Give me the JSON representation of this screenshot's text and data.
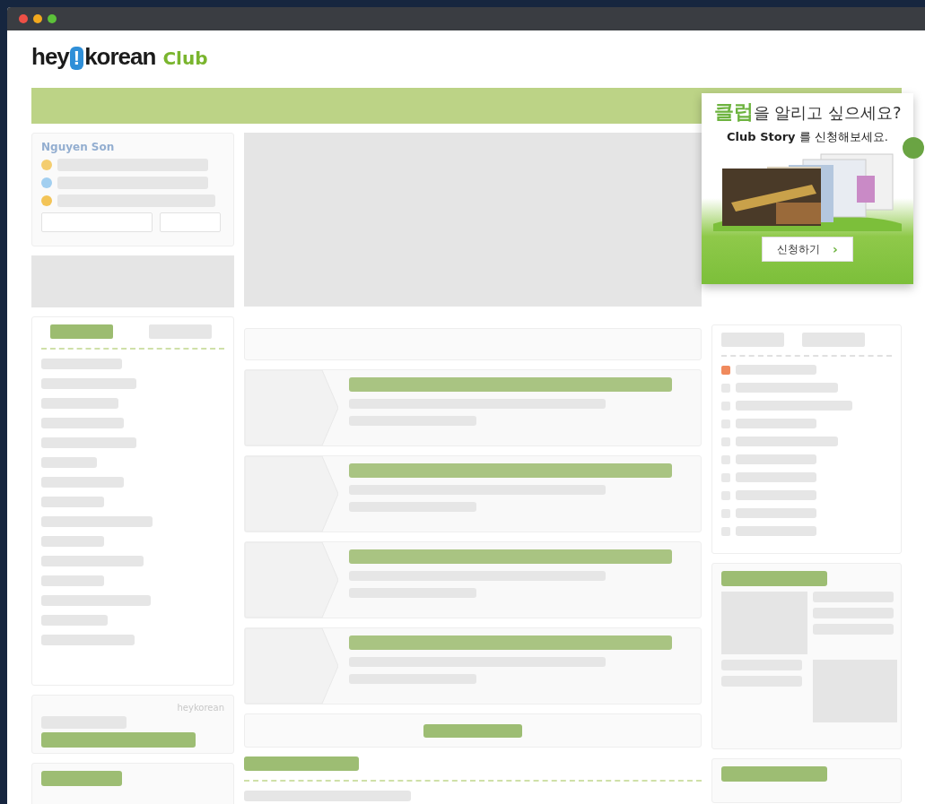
{
  "logo": {
    "hey": "hey",
    "mark": "!",
    "korean": "korean",
    "club": "Club"
  },
  "profile": {
    "name": "Nguyen Son"
  },
  "side_tabs": [
    {
      "selected": true
    },
    {
      "selected": false
    }
  ],
  "footer_card": {
    "label": "heykorean"
  },
  "ad": {
    "highlight": "클럽",
    "headline": "을 알리고 싶으세요?",
    "subline": "**Club Story** 를 신청해보세요.",
    "button": "신청하기",
    "button_arrow": "›"
  },
  "right_list": [
    {
      "checked": true
    },
    {
      "checked": false
    },
    {
      "checked": false
    },
    {
      "checked": false
    },
    {
      "checked": false
    },
    {
      "checked": false
    },
    {
      "checked": false
    },
    {
      "checked": false
    },
    {
      "checked": false
    },
    {
      "checked": false
    }
  ]
}
